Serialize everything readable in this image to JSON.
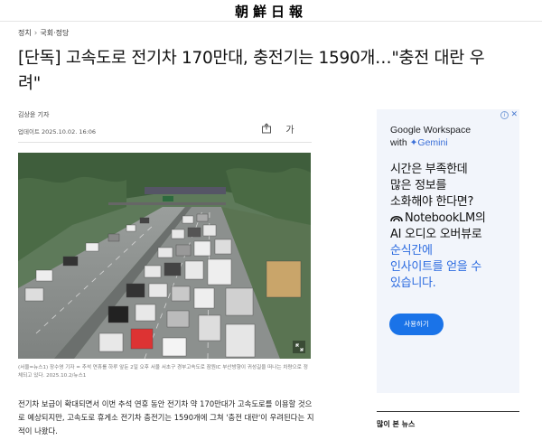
{
  "masthead": {
    "logo": "朝鮮日報"
  },
  "breadcrumb": {
    "section": "정치",
    "subsection": "국회·정당"
  },
  "article": {
    "headline": "[단독] 고속도로 전기차 170만대, 충전기는 1590개…\"충전 대란 우려\"",
    "byline": "김상윤 기자",
    "updated": "업데이트 2025.10.02. 16:06",
    "font_size_label": "가",
    "caption": "(서울=뉴스1) 장수영 기자 = 추석 연휴를 하루 앞둔 2일 오후 서울 서초구 경부고속도로 잠원IC 부산방향이 귀성길을 떠나는 차량으로 정체되고 있다. 2025.10.2/뉴스1",
    "body": "전기차 보급이 확대되면서 이번 추석 연휴 동안 전기차 약 170만대가 고속도로를 이용할 것으로 예상되지만, 고속도로 휴게소 전기차 충전기는 1590개에 그쳐 '충전 대란'이 우려된다는 지적이 나왔다."
  },
  "ad": {
    "brand_line1": "Google Workspace",
    "brand_with": "with",
    "brand_gemini": "Gemini",
    "copy_line1": "시간은 부족한데",
    "copy_line2": "많은 정보를",
    "copy_line3": "소화해야 한다면?",
    "copy_line4_suffix": "NotebookLM의",
    "copy_line5": "AI 오디오 오버뷰로",
    "copy_highlight1": "순식간에",
    "copy_highlight2": "인사이트를 얻을 수",
    "copy_highlight3": "있습니다.",
    "cta": "사용하기",
    "accent_color": "#1a73e8"
  },
  "sidebar": {
    "most_read": "많이 본 뉴스"
  },
  "icons": [
    "share-icon",
    "font-size-icon",
    "expand-icon",
    "ad-info-icon",
    "ad-close-icon",
    "sparkle-icon",
    "notebooklm-icon"
  ]
}
